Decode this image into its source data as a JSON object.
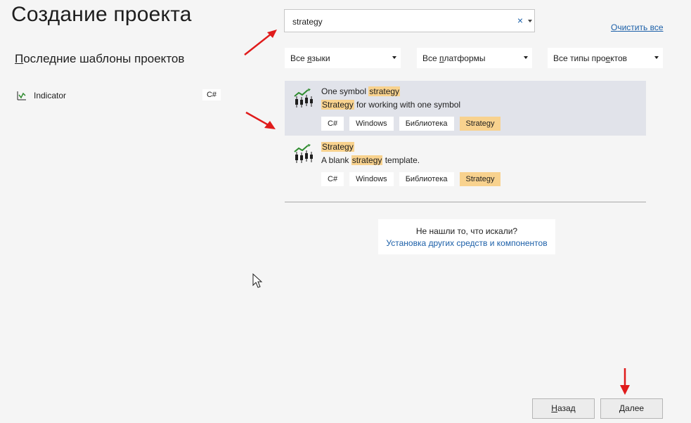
{
  "title": "Создание проекта",
  "recent": {
    "heading_underlined": "П",
    "heading_rest": "оследние шаблоны проектов",
    "items": [
      {
        "name": "Indicator",
        "lang": "C#",
        "icon": "chart-icon"
      }
    ]
  },
  "search": {
    "value": "strategy",
    "clear_glyph": "×"
  },
  "clear_all": {
    "underlined": "О",
    "rest": "чистить все"
  },
  "filters": [
    {
      "pre": "Все ",
      "underlined": "я",
      "post": "зыки"
    },
    {
      "pre": "Все ",
      "underlined": "п",
      "post": "латформы"
    },
    {
      "pre": "Все типы про",
      "underlined": "е",
      "post": "ктов"
    }
  ],
  "templates": [
    {
      "title_pre": "One symbol ",
      "title_hl": "strategy",
      "title_post": "",
      "desc_pre": "",
      "desc_hl": "Strategy",
      "desc_post": " for working with one symbol",
      "tags": [
        "C#",
        "Windows",
        "Библиотека",
        "Strategy"
      ],
      "selected": true
    },
    {
      "title_pre": "",
      "title_hl": "Strategy",
      "title_post": "",
      "desc_pre": "A blank ",
      "desc_hl": "strategy",
      "desc_post": " template.",
      "tags": [
        "C#",
        "Windows",
        "Библиотека",
        "Strategy"
      ],
      "selected": false
    }
  ],
  "not_found": {
    "question": "Не нашли то, что искали?",
    "link": "Установка других средств и компонентов"
  },
  "buttons": {
    "back_underlined": "Н",
    "back_rest": "азад",
    "next_underlined": "Д",
    "next_rest": "алее"
  },
  "colors": {
    "accent_link": "#1b5fa8",
    "highlight": "#f8d28e",
    "selected_row": "#e1e3ea",
    "annotation_arrow": "#e01b1b"
  }
}
